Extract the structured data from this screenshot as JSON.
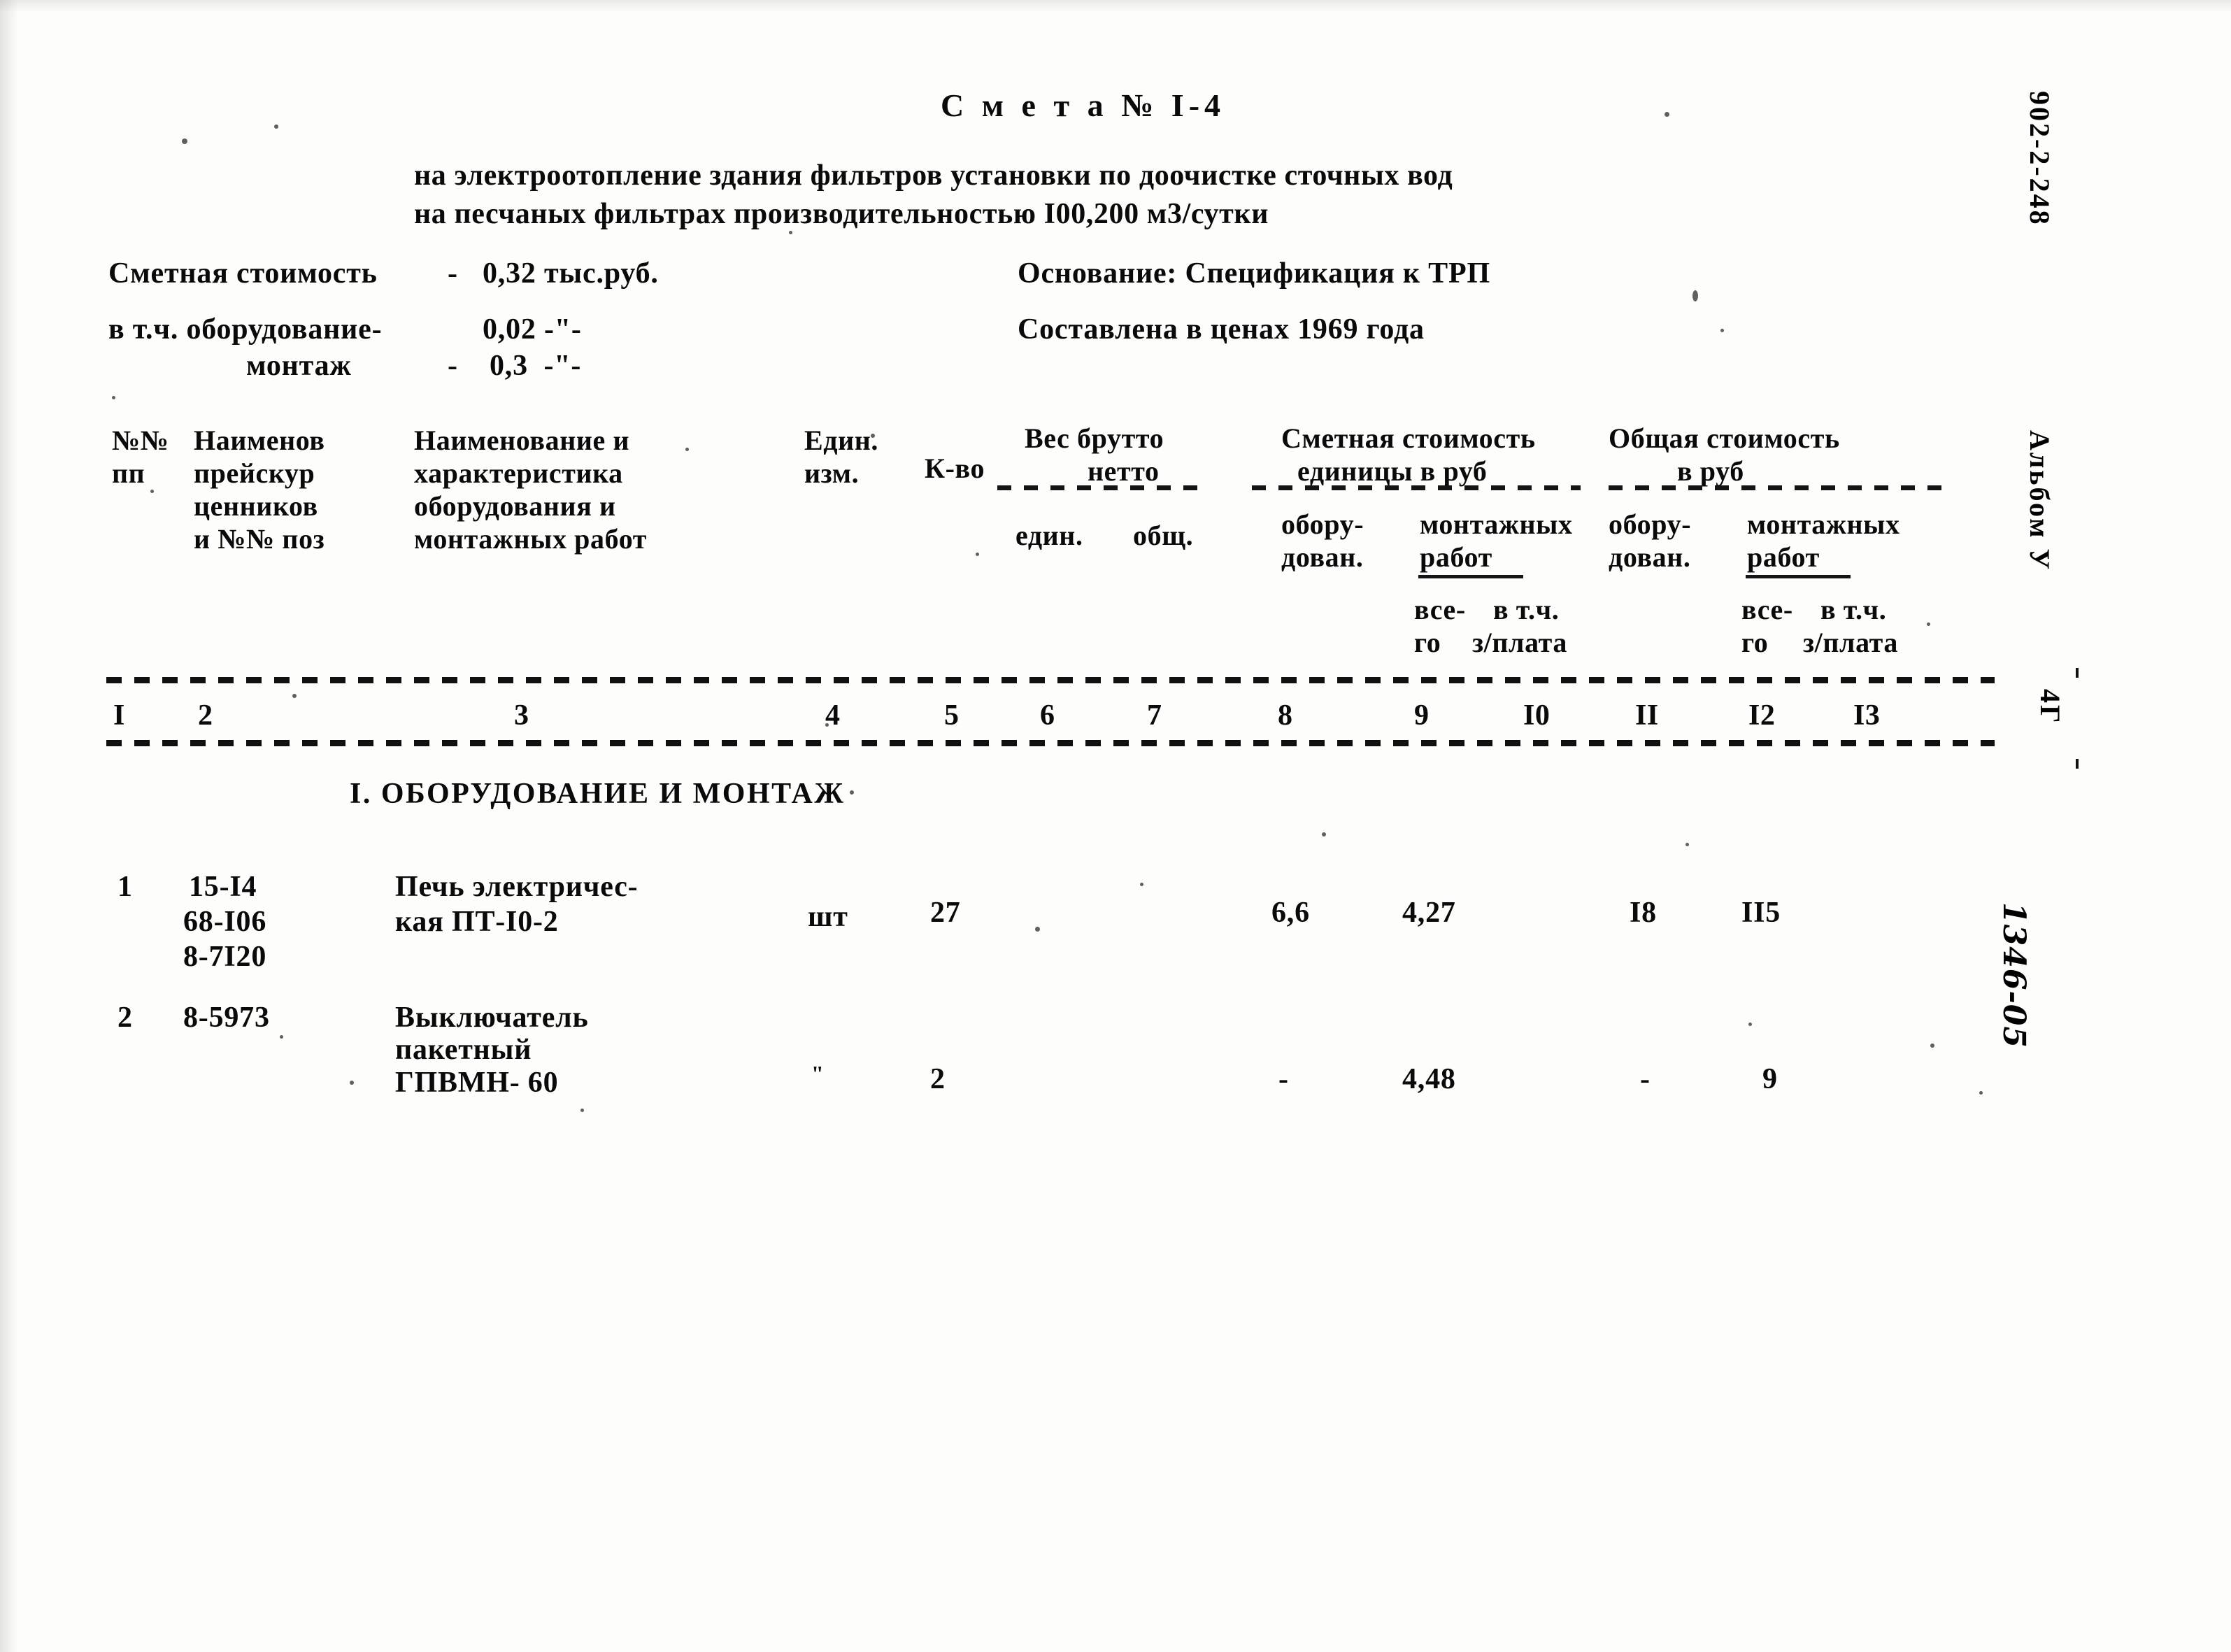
{
  "document": {
    "title": "С м е т а № I-4",
    "subtitle_line1": "на электроотопление здания фильтров установки по доочистке сточных вод",
    "subtitle_line2": "на песчаных фильтрах производительностью I00,200 м3/сутки"
  },
  "summary": {
    "left": [
      {
        "label": "Сметная стоимость",
        "dash": "-",
        "value": "0,32 тыс.руб."
      },
      {
        "label": "в т.ч. оборудование-",
        "dash": "",
        "value": "0,02 -\"-"
      },
      {
        "label": "монтаж",
        "dash": "-",
        "value": "0,3  -\"-"
      }
    ],
    "right": [
      "Основание: Спецификация к ТРП",
      "Составлена в ценах 1969 года"
    ]
  },
  "table": {
    "headers": {
      "col1": [
        "№№",
        "пп"
      ],
      "col2": [
        "Наименов",
        "прейскур",
        "ценников",
        "и №№ поз"
      ],
      "col3": [
        "Наименование и",
        "характеристика",
        "оборудования и",
        "монтажных работ"
      ],
      "col4": [
        "Един.",
        "изм."
      ],
      "col5": [
        "К-во"
      ],
      "weight_group": {
        "title_top": "Вес брутто",
        "title_bottom": "нетто",
        "sub_left": "един.",
        "sub_right": "общ."
      },
      "unit_cost_group": {
        "title_top": "Сметная стоимость",
        "title_bottom": "единицы в руб",
        "sub_left_top": "обору-",
        "sub_left_bottom": "дован.",
        "sub_right_top": "монтажных",
        "sub_right_bottom": "работ"
      },
      "total_cost_group": {
        "title_top": "Общая стоимость",
        "title_bottom": "в руб",
        "sub_left_top": "обору-",
        "sub_left_bottom": "дован.",
        "sub_right_top": "монтажных",
        "sub_right_bottom": "работ"
      },
      "vsego_left": {
        "top": "все-",
        "bottom": "го",
        "right_top": "в т.ч.",
        "right_bottom": "з/плата"
      },
      "vsego_right": {
        "top": "все-",
        "bottom": "го",
        "right_top": "в т.ч.",
        "right_bottom": "з/плата"
      }
    },
    "column_numbers": [
      "I",
      "2",
      "3",
      "4",
      "5",
      "6",
      "7",
      "8",
      "9",
      "I0",
      "II",
      "I2",
      "I3"
    ],
    "sections": [
      {
        "heading": "I. ОБОРУДОВАНИЕ И МОНТАЖ",
        "rows": [
          {
            "no": "1",
            "price_codes": [
              "15-I4",
              "68-I06",
              "8-7I20"
            ],
            "name_lines": [
              "Печь электричес-",
              "кая ПТ-I0-2"
            ],
            "unit": "шт",
            "qty": "27",
            "weight_unit": "",
            "weight_total": "",
            "unit_equip": "6,6",
            "unit_install": "4,27",
            "unit_install_salary": "",
            "total_equip": "I8",
            "total_install": "II5",
            "total_install_salary": ""
          },
          {
            "no": "2",
            "price_codes": [
              "8-5973"
            ],
            "name_lines": [
              "Выключатель",
              "пакетный",
              "ГПВМН- 60"
            ],
            "unit": "\"",
            "qty": "2",
            "weight_unit": "",
            "weight_total": "",
            "unit_equip": "-",
            "unit_install": "4,48",
            "unit_install_salary": "",
            "total_equip": "-",
            "total_install": "9",
            "total_install_salary": ""
          }
        ]
      }
    ]
  },
  "margin": {
    "album_code": "902-2-248",
    "album_label": "Альбом У",
    "sheet_label": "4Г",
    "stamp": "1346-05"
  }
}
